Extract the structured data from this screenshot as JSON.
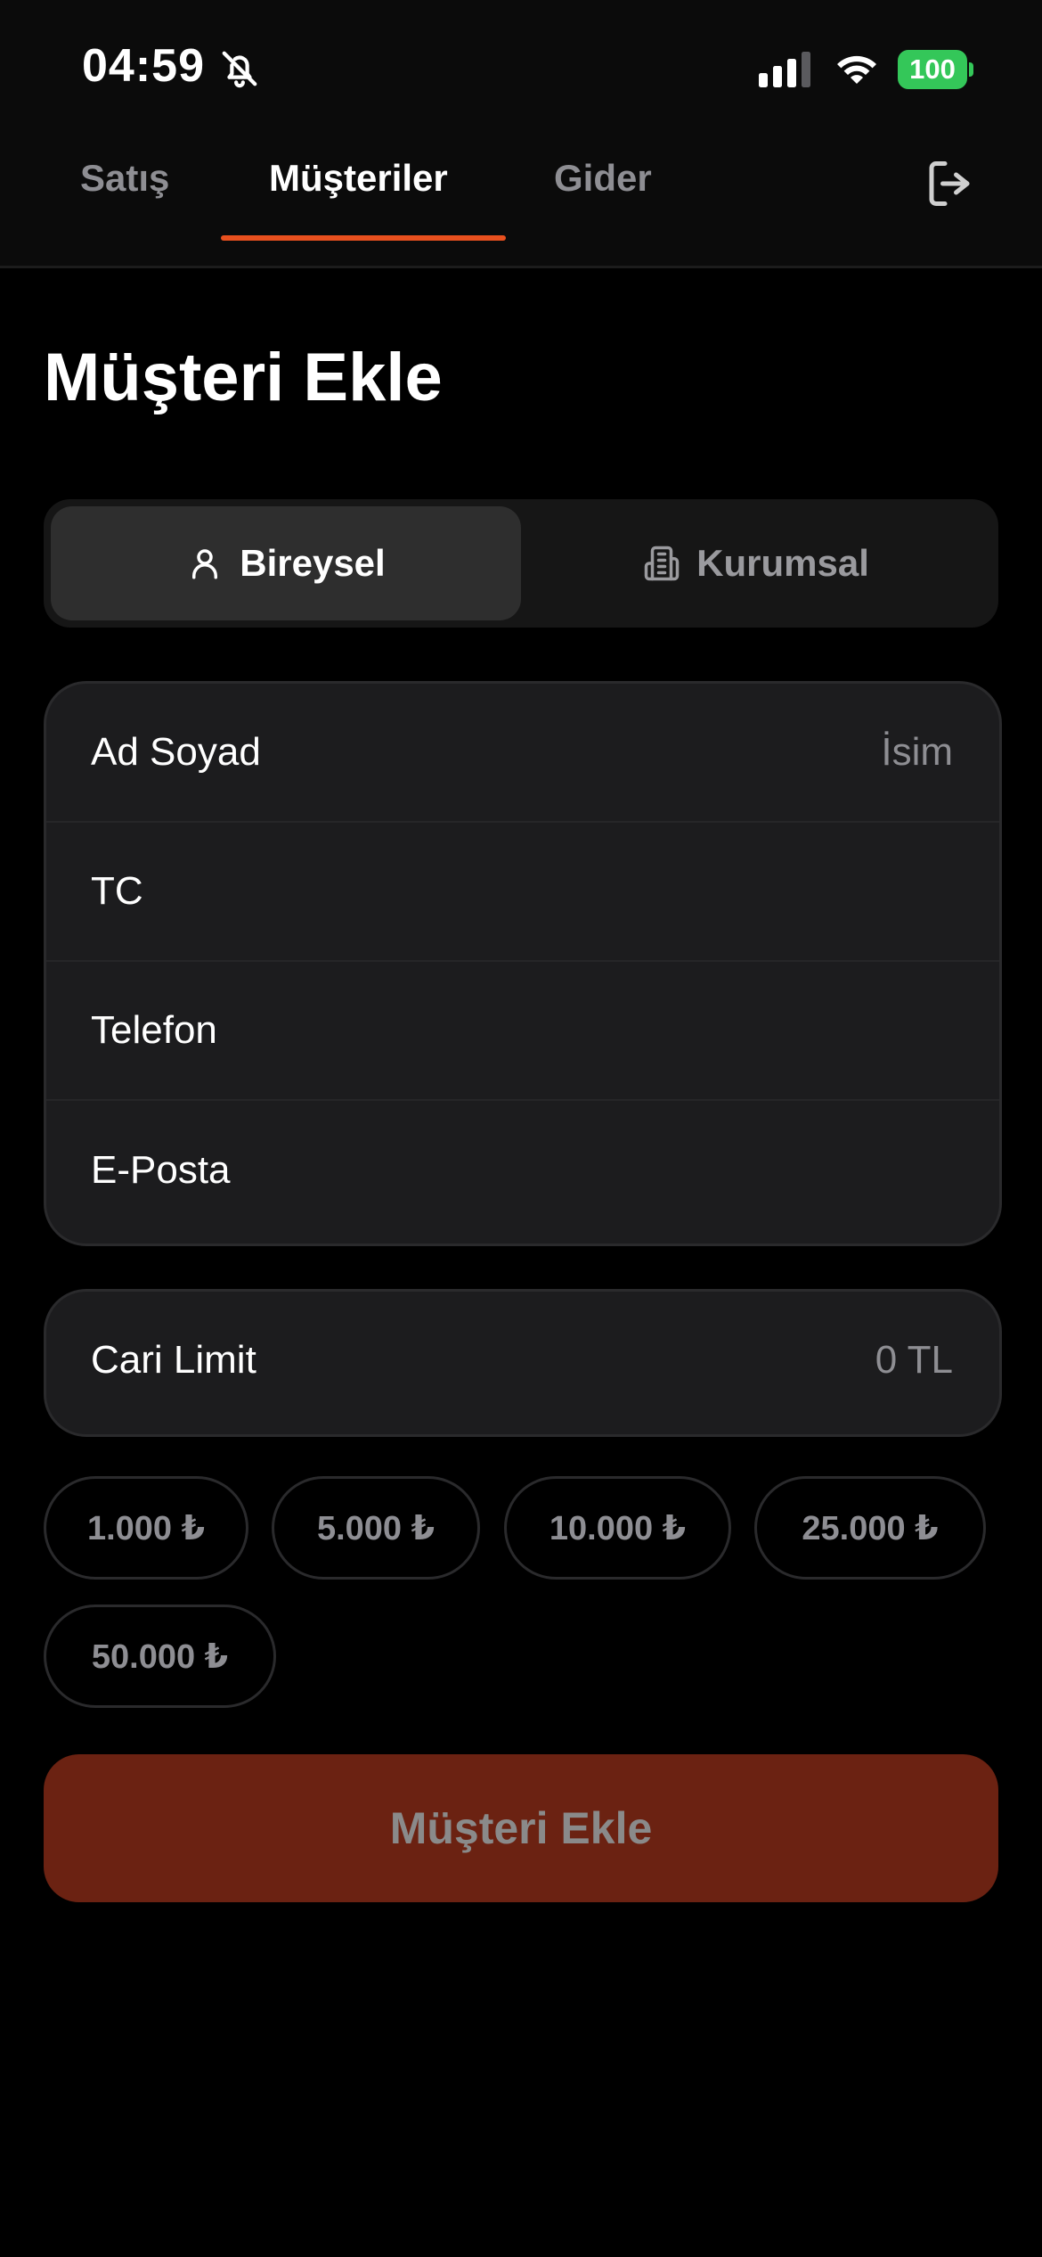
{
  "status_bar": {
    "time": "04:59",
    "battery": "100",
    "icons": [
      "bell-slash-icon",
      "signal-icon",
      "wifi-icon",
      "battery-icon"
    ]
  },
  "tabs": [
    {
      "label": "Satış",
      "active": false
    },
    {
      "label": "Müşteriler",
      "active": true
    },
    {
      "label": "Gider",
      "active": false
    }
  ],
  "header": {
    "logout_icon": "logout-icon"
  },
  "page": {
    "title": "Müşteri Ekle"
  },
  "segment": {
    "options": [
      {
        "label": "Bireysel",
        "icon": "person-icon",
        "selected": true
      },
      {
        "label": "Kurumsal",
        "icon": "building-icon",
        "selected": false
      }
    ]
  },
  "form": {
    "fields": [
      {
        "label": "Ad Soyad",
        "placeholder": "İsim",
        "value": ""
      },
      {
        "label": "TC",
        "placeholder": "",
        "value": ""
      },
      {
        "label": "Telefon",
        "placeholder": "",
        "value": ""
      },
      {
        "label": "E-Posta",
        "placeholder": "",
        "value": ""
      }
    ]
  },
  "limit": {
    "label": "Cari Limit",
    "placeholder": "0 TL"
  },
  "quick_amounts": [
    "1.000 ₺",
    "5.000 ₺",
    "10.000 ₺",
    "25.000 ₺",
    "50.000 ₺"
  ],
  "submit": {
    "label": "Müşteri Ekle"
  },
  "colors": {
    "accent": "#e8501e",
    "submit_bg": "#6b2212",
    "battery": "#34c759",
    "background": "#000000",
    "card": "#1c1c1e"
  }
}
